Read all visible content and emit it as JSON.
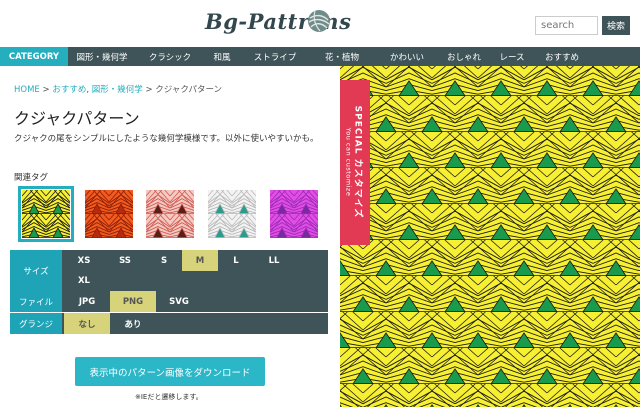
{
  "header": {
    "logo": "Bg-Pattrens",
    "search_placeholder": "search",
    "search_button": "検索"
  },
  "nav": {
    "items": [
      {
        "label": "CATEGORY",
        "active": true
      },
      {
        "label": "図形・幾何学"
      },
      {
        "label": "クラシック"
      },
      {
        "label": "和風"
      },
      {
        "label": "ストライプ"
      },
      {
        "label": "花・植物"
      },
      {
        "label": "かわいい"
      },
      {
        "label": "おしゃれ"
      },
      {
        "label": "レース"
      },
      {
        "label": "おすすめ"
      }
    ]
  },
  "breadcrumb": {
    "home": "HOME",
    "sep": " > ",
    "cat1": "おすすめ",
    "comma": ", ",
    "cat2": "図形・幾何学",
    "current": "クジャクパターン"
  },
  "page": {
    "title": "クジャクパターン",
    "description": "クジャクの尾をシンプルにしたような幾何学模様です。以外に使いやすいかも。",
    "tags_label": "関連タグ"
  },
  "thumbnails": [
    {
      "name": "yellow-green",
      "bg": "#f7f032",
      "accent": "#1a9a4c",
      "line": "#1a1a1a",
      "selected": true
    },
    {
      "name": "orange-red",
      "bg": "#f25a1e",
      "accent": "#b82a10",
      "line": "#8a1f08"
    },
    {
      "name": "pink-brown",
      "bg": "#f4c9c2",
      "accent": "#5a1e12",
      "line": "#d05b52"
    },
    {
      "name": "white-teal",
      "bg": "#f3f3f3",
      "accent": "#2a9c8d",
      "line": "#b9b9b9"
    },
    {
      "name": "magenta-purple",
      "bg": "#e24ee3",
      "accent": "#7a2aa0",
      "line": "#9b2bb8"
    }
  ],
  "options": {
    "size": {
      "label": "サイズ",
      "values": [
        "XS",
        "SS",
        "S",
        "M",
        "L",
        "LL",
        "XL"
      ],
      "selected": "M"
    },
    "file": {
      "label": "ファイル",
      "values": [
        "JPG",
        "PNG",
        "SVG"
      ],
      "selected": "PNG"
    },
    "grunge": {
      "label": "グランジ",
      "values": [
        "なし",
        "あり"
      ],
      "selected": "なし"
    }
  },
  "download": {
    "button": "表示中のパターン画像をダウンロード",
    "note": "※IEだと遷移します。"
  },
  "special_tab": {
    "main": "SPECIAL カスタマイズ",
    "sub": "You can customize"
  },
  "colors": {
    "nav_bg": "#3f5458",
    "accent": "#25aebd",
    "pattern_bg": "#f7f032",
    "pattern_accent": "#1a9a4c",
    "selected_option": "#d7d37a",
    "special": "#e23a55"
  }
}
